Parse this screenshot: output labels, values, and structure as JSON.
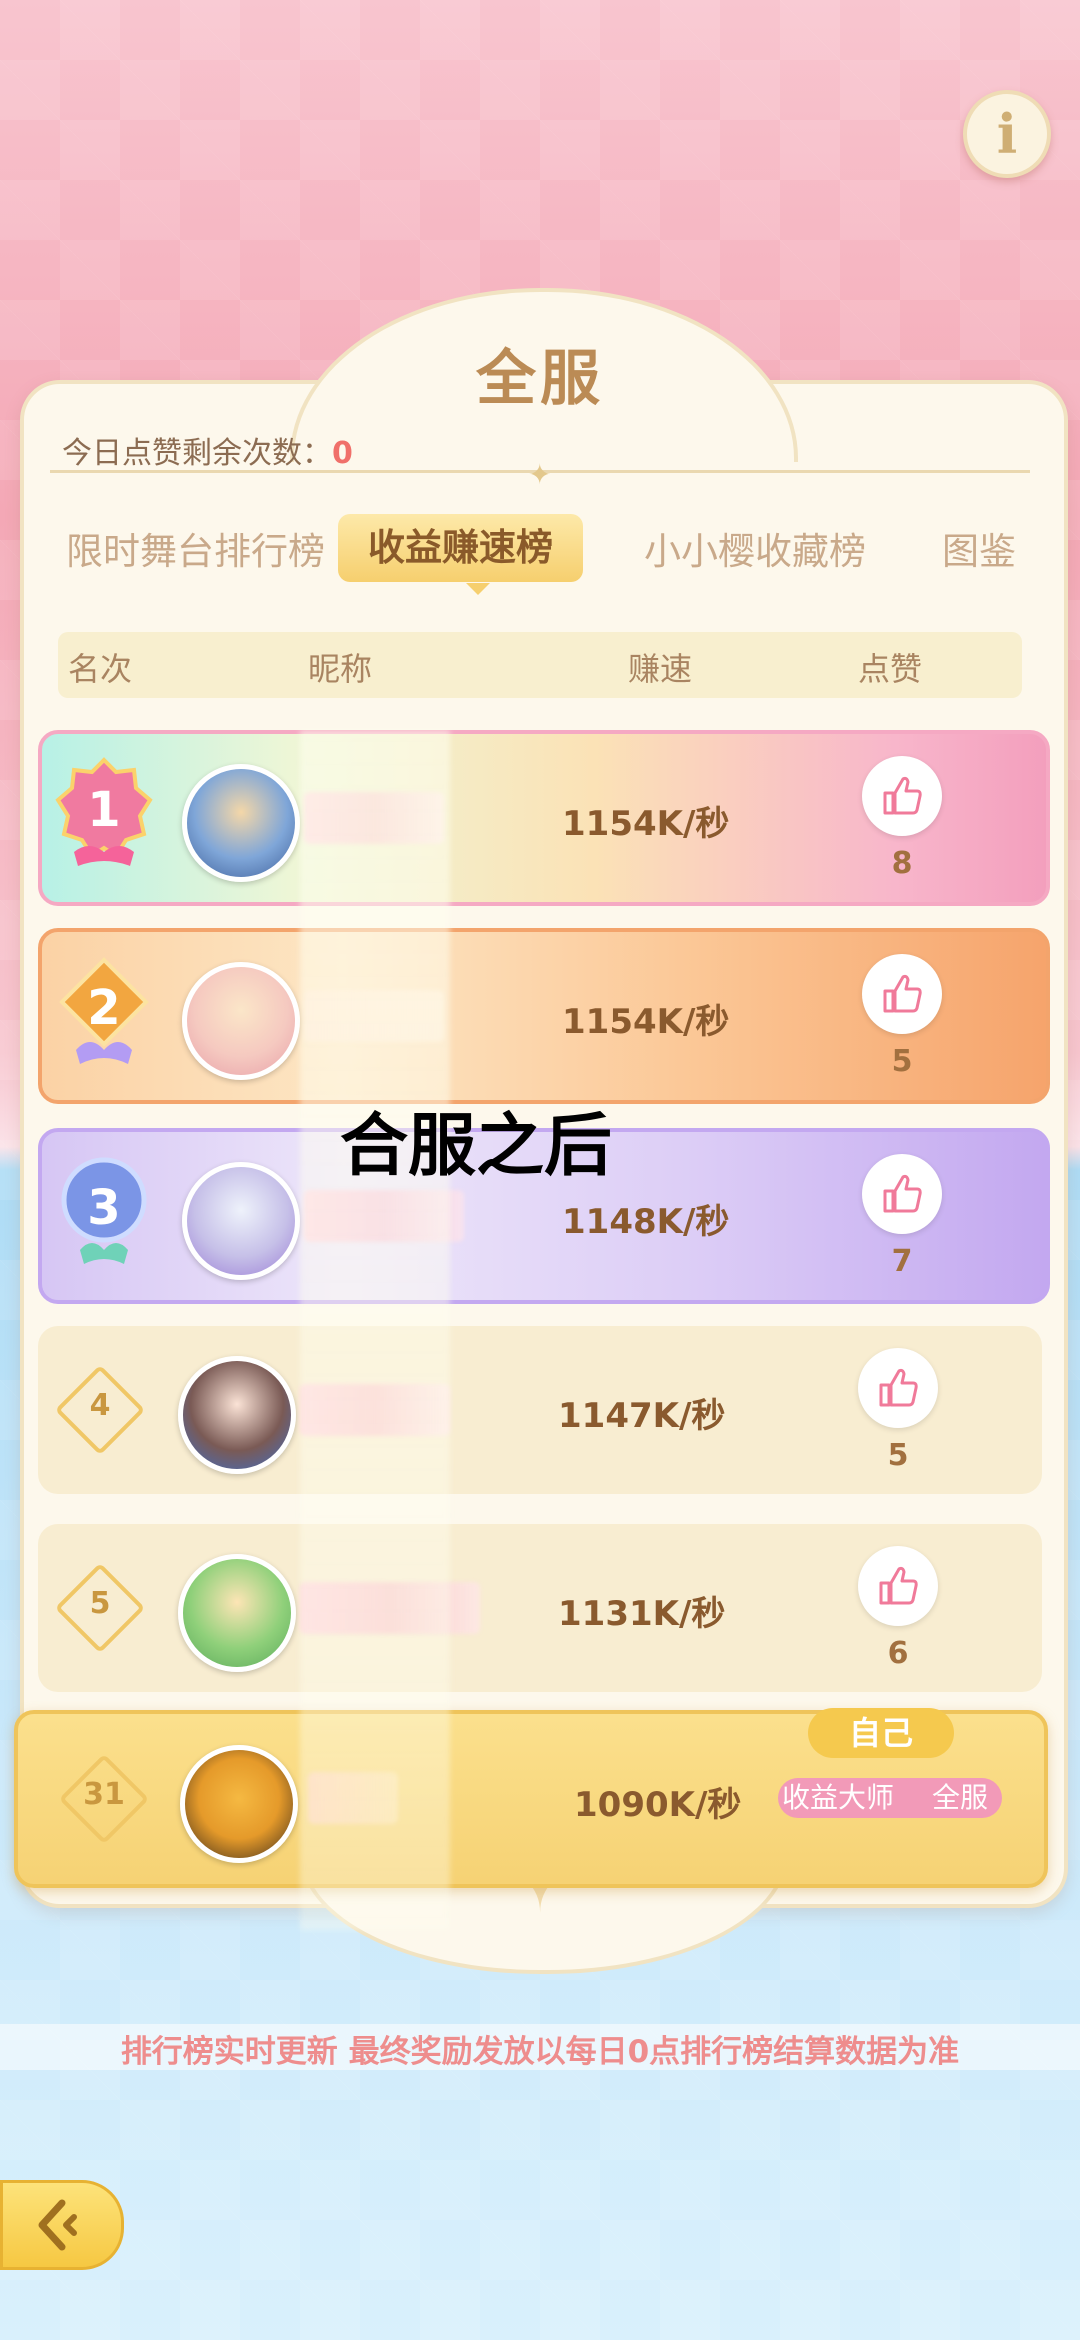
{
  "title": "全服",
  "likes_remaining": {
    "label": "今日点赞剩余次数：",
    "value": "0"
  },
  "tabs": [
    {
      "label": "限时舞台排行榜"
    },
    {
      "label": "收益赚速榜"
    },
    {
      "label": "小小樱收藏榜"
    },
    {
      "label": "图鉴"
    }
  ],
  "columns": {
    "rank": "名次",
    "nickname": "昵称",
    "speed": "赚速",
    "likes": "点赞"
  },
  "rows": [
    {
      "rank": "1",
      "speed": "1154K/秒",
      "likes": "8"
    },
    {
      "rank": "2",
      "speed": "1154K/秒",
      "likes": "5"
    },
    {
      "rank": "3",
      "speed": "1148K/秒",
      "likes": "7"
    },
    {
      "rank": "4",
      "speed": "1147K/秒",
      "likes": "5"
    },
    {
      "rank": "5",
      "speed": "1131K/秒",
      "likes": "6"
    }
  ],
  "self": {
    "tag": "自己",
    "rank": "31",
    "speed": "1090K/秒",
    "title_left": "收益大师",
    "title_right": "全服"
  },
  "overlay_text": "合服之后",
  "notice": "排行榜实时更新 最终奖励发放以每日0点排行榜结算数据为准",
  "colors": {
    "accent": "#f6cf6e",
    "rank1": "#f39fbd",
    "rank2": "#f6a46c",
    "rank3": "#c3a8f0"
  }
}
